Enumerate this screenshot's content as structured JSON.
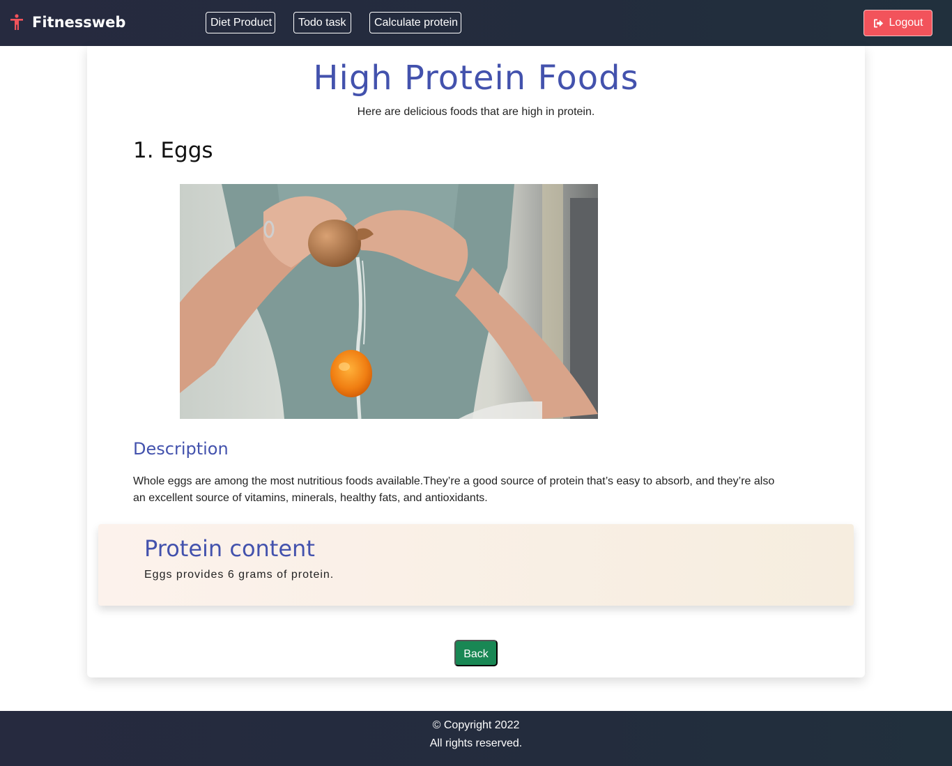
{
  "navbar": {
    "brand": "Fitnessweb",
    "brand_icon": "person-figure-icon",
    "links": [
      {
        "label": "Diet Product"
      },
      {
        "label": "Todo task"
      },
      {
        "label": "Calculate protein"
      }
    ],
    "logout_label": "Logout",
    "logout_icon": "sign-out-icon",
    "accent_color": "#f2535b"
  },
  "main": {
    "title": "High Protein Foods",
    "subtitle": "Here are delicious foods that are high in protein.",
    "food_heading": "1. Eggs",
    "image_subject": "egg-cracking-photo",
    "description_heading": "Description",
    "description_text": "Whole eggs are among the most nutritious foods available.They’re a good source of protein that’s easy to absorb, and they’re also an excellent source of vitamins, minerals, healthy fats, and antioxidants.",
    "protein_heading": "Protein content",
    "protein_text": "Eggs provides 6 grams of protein.",
    "back_label": "Back",
    "title_color": "#4352ad",
    "back_color": "#198754"
  },
  "footer": {
    "line1": "© Copyright 2022",
    "line2": "All rights reserved."
  }
}
